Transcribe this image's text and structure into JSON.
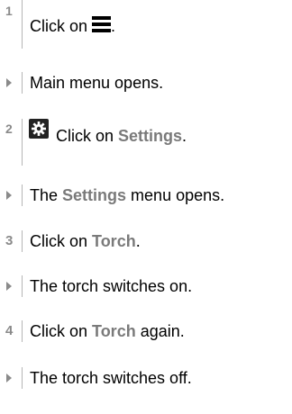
{
  "steps": [
    {
      "type": "step",
      "number": "1",
      "parts": [
        "Click on ",
        "."
      ]
    },
    {
      "type": "result",
      "text": "Main menu opens."
    },
    {
      "type": "step",
      "number": "2",
      "parts": [
        "Click on ",
        "Settings",
        "."
      ]
    },
    {
      "type": "result",
      "parts": [
        "The ",
        "Settings",
        " menu opens."
      ]
    },
    {
      "type": "step",
      "number": "3",
      "parts": [
        "Click on ",
        "Torch",
        "."
      ]
    },
    {
      "type": "result",
      "text": "The torch switches on."
    },
    {
      "type": "step",
      "number": "4",
      "parts": [
        "Click on ",
        "Torch",
        " again."
      ]
    },
    {
      "type": "result",
      "text": "The torch switches off."
    }
  ],
  "icons": {
    "step1": "menu-icon",
    "step2": "gear-icon"
  }
}
